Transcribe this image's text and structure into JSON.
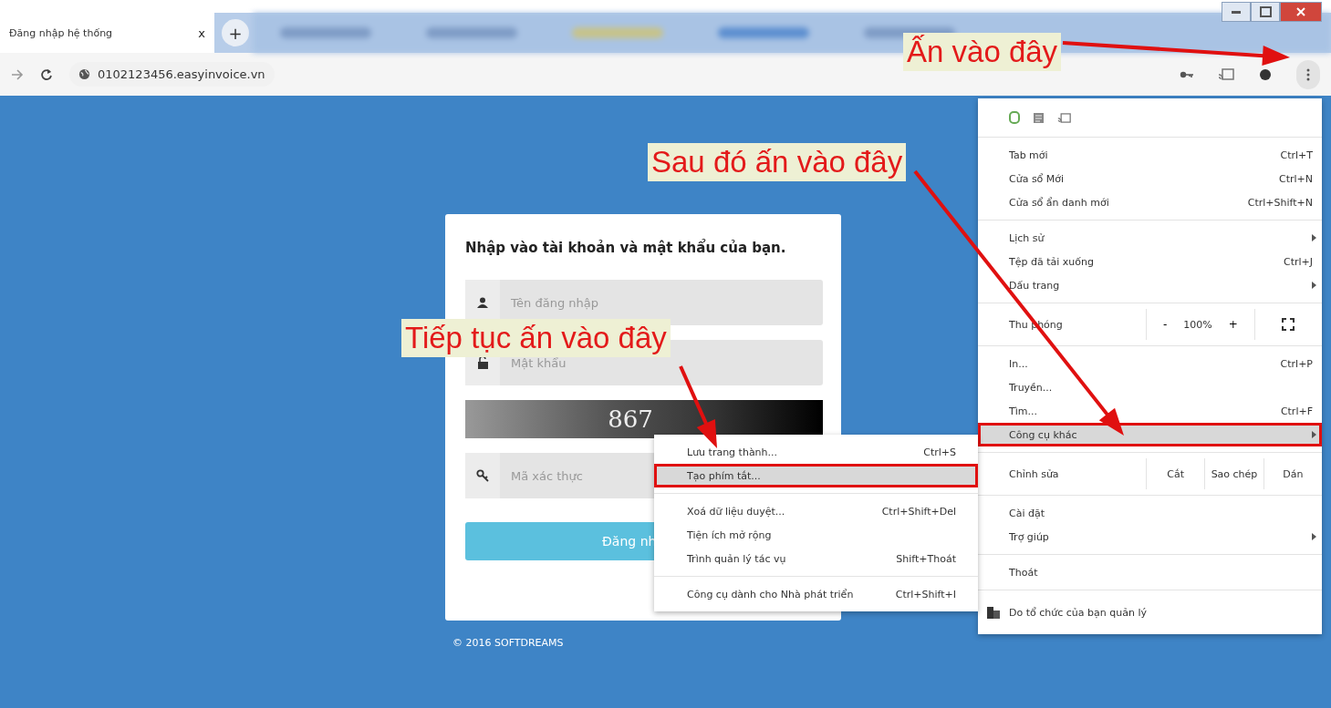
{
  "browser": {
    "tabs": [
      {
        "title": "Đăng nhập hệ thống",
        "close": "x",
        "selected": true
      }
    ],
    "new_tab": "+",
    "address": "0102123456.easyinvoice.vn"
  },
  "login": {
    "heading": "Nhập vào tài khoản và mật khẩu của bạn.",
    "fields": [
      {
        "kind": "user",
        "placeholder": "Tên đăng nhập"
      },
      {
        "kind": "lock",
        "placeholder": "Mật khẩu"
      },
      {
        "kind": "captcha",
        "value": "867"
      },
      {
        "kind": "key",
        "placeholder": "Mã xác thực"
      }
    ],
    "button": "Đăng nh",
    "footer": "© 2016 SOFTDREAMS"
  },
  "menu": {
    "sections": [
      [
        {
          "kind": "item",
          "label": "Tab mới",
          "shortcut": "Ctrl+T",
          "submenu": false,
          "selected": false
        },
        {
          "kind": "item",
          "label": "Cửa sổ Mới",
          "shortcut": "Ctrl+N",
          "submenu": false,
          "selected": false
        },
        {
          "kind": "item",
          "label": "Cửa sổ ẩn danh mới",
          "shortcut": "Ctrl+Shift+N",
          "submenu": false,
          "selected": false
        }
      ],
      [
        {
          "kind": "item",
          "label": "Lịch sử",
          "submenu": true,
          "selected": false
        },
        {
          "kind": "item",
          "label": "Tệp đã tải xuống",
          "shortcut": "Ctrl+J",
          "submenu": false,
          "selected": false
        },
        {
          "kind": "item",
          "label": "Dấu trang",
          "submenu": true,
          "selected": false
        }
      ],
      [
        {
          "kind": "zoom",
          "label": "Thu phóng",
          "minus": "-",
          "value": "100%",
          "plus": "+"
        }
      ],
      [
        {
          "kind": "item",
          "label": "In...",
          "shortcut": "Ctrl+P",
          "submenu": false,
          "selected": false
        },
        {
          "kind": "item",
          "label": "Truyền...",
          "submenu": false,
          "selected": false
        },
        {
          "kind": "item",
          "label": "Tìm...",
          "shortcut": "Ctrl+F",
          "submenu": false,
          "selected": false
        },
        {
          "kind": "item",
          "label": "Công cụ khác",
          "submenu": true,
          "selected": true
        }
      ],
      [
        {
          "kind": "edit",
          "label": "Chỉnh sửa",
          "actions": [
            "Cắt",
            "Sao chép",
            "Dán"
          ]
        }
      ],
      [
        {
          "kind": "item",
          "label": "Cài đặt",
          "submenu": false,
          "selected": false
        },
        {
          "kind": "item",
          "label": "Trợ giúp",
          "submenu": true,
          "selected": false
        }
      ],
      [
        {
          "kind": "item",
          "label": "Thoát",
          "submenu": false,
          "selected": false
        }
      ]
    ],
    "managed": "Do tổ chức của bạn quản lý"
  },
  "submenu": {
    "sections": [
      [
        {
          "label": "Lưu trang thành...",
          "shortcut": "Ctrl+S",
          "selected": false
        },
        {
          "label": "Tạo phím tắt...",
          "selected": true
        }
      ],
      [
        {
          "label": "Xoá dữ liệu duyệt...",
          "shortcut": "Ctrl+Shift+Del",
          "selected": false
        },
        {
          "label": "Tiện ích mở rộng",
          "selected": false
        },
        {
          "label": "Trình quản lý tác vụ",
          "shortcut": "Shift+Thoát",
          "selected": false
        }
      ],
      [
        {
          "label": "Công cụ dành cho Nhà phát triển",
          "shortcut": "Ctrl+Shift+I",
          "selected": false
        }
      ]
    ]
  },
  "annotations": [
    {
      "text": "Ấn vào đây"
    },
    {
      "text": "Sau đó ấn vào đây"
    },
    {
      "text": "Tiếp tục ấn vào đây"
    }
  ]
}
